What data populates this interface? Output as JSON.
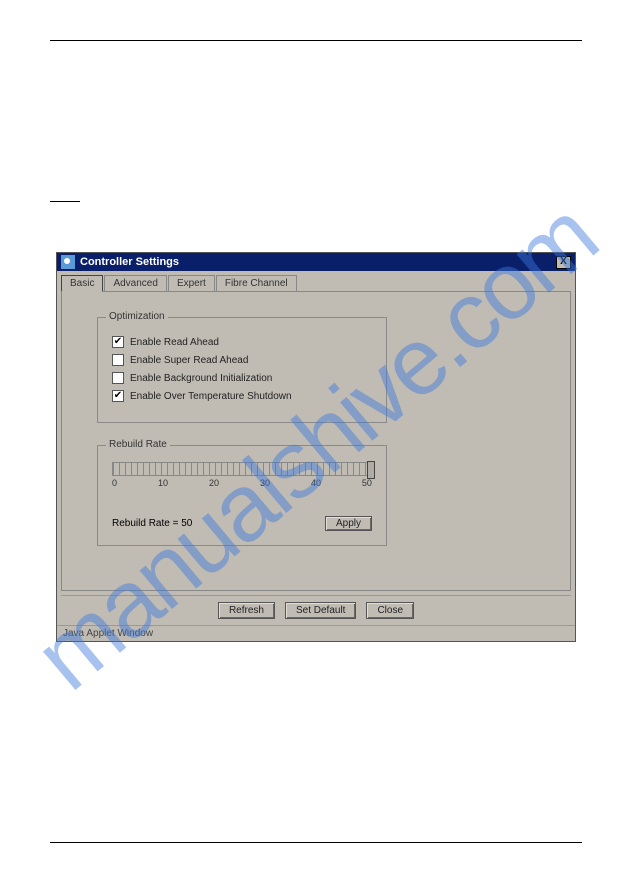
{
  "window": {
    "title": "Controller Settings"
  },
  "tabs": [
    "Basic",
    "Advanced",
    "Expert",
    "Fibre Channel"
  ],
  "optimization": {
    "legend": "Optimization",
    "items": [
      {
        "label": "Enable Read Ahead",
        "checked": true
      },
      {
        "label": "Enable Super Read Ahead",
        "checked": false
      },
      {
        "label": "Enable Background Initialization",
        "checked": false
      },
      {
        "label": "Enable Over Temperature Shutdown",
        "checked": true
      }
    ]
  },
  "rebuild": {
    "legend": "Rebuild Rate",
    "ticks": [
      "0",
      "10",
      "20",
      "30",
      "40",
      "50"
    ],
    "value_label": "Rebuild Rate = 50",
    "apply": "Apply"
  },
  "buttons": {
    "refresh": "Refresh",
    "setdefault": "Set Default",
    "close": "Close"
  },
  "status": "Java Applet Window",
  "watermark": "manualshive.com"
}
